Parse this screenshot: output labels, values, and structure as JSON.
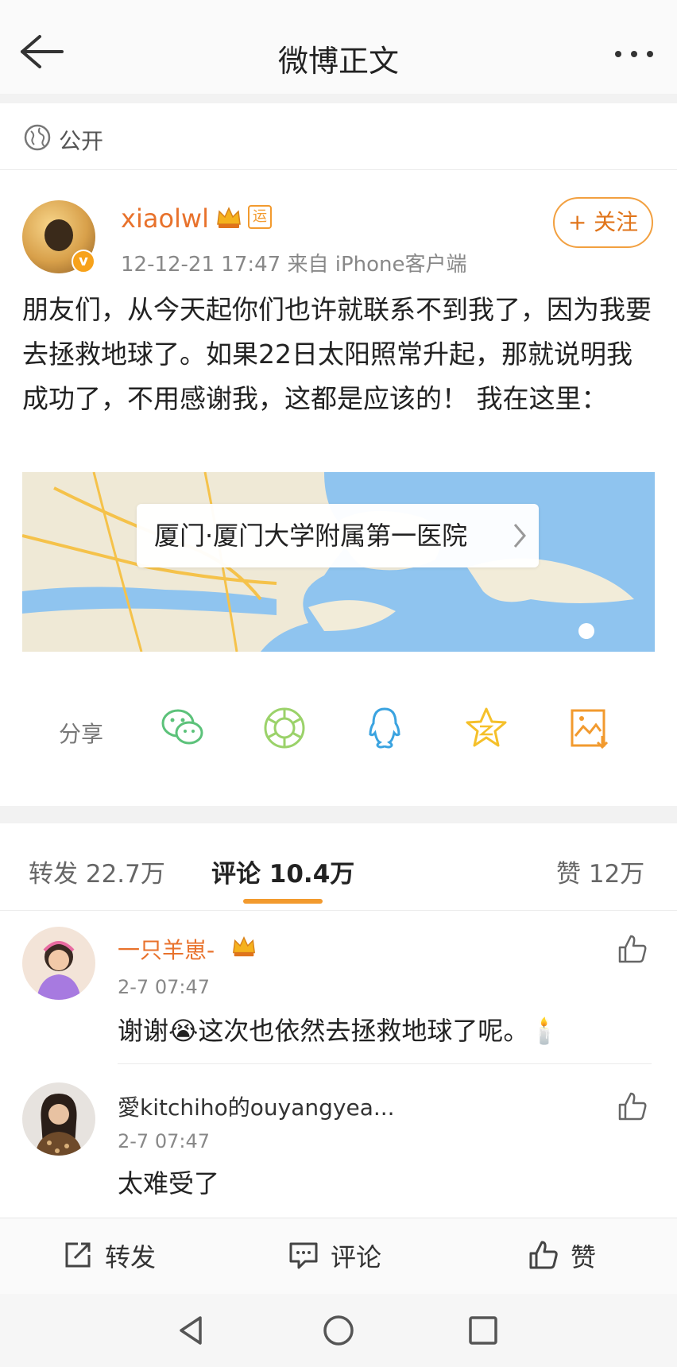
{
  "header": {
    "title": "微博正文"
  },
  "privacy": {
    "label": "公开"
  },
  "post": {
    "username": "xiaolwl",
    "run_badge": "运",
    "verified_badge": "v",
    "meta": "12-12-21 17:47  来自 iPhone客户端",
    "follow_label": "+ 关注",
    "text": "朋友们，从今天起你们也许就联系不到我了，因为我要去拯救地球了。如果22日太阳照常升起，那就说明我成功了，不用感谢我，这都是应该的！ 我在这里：",
    "location": "厦门·厦门大学附属第一医院"
  },
  "share": {
    "label": "分享",
    "icons": [
      "wechat-icon",
      "moments-icon",
      "qq-icon",
      "qzone-icon",
      "save-image-icon"
    ]
  },
  "tabs": {
    "repost": "转发 22.7万",
    "comment": "评论 10.4万",
    "like": "赞 12万"
  },
  "comments": [
    {
      "name": "一只羊崽-",
      "time": "2-7 07:47",
      "text": "谢谢😭这次也依然去拯救地球了呢。🕯️",
      "name_color": "#e8722c"
    },
    {
      "name": "愛kitchiho的ouyangyea...",
      "time": "2-7 07:47",
      "text": "太难受了",
      "name_color": "#333333"
    }
  ],
  "bottom_bar": {
    "repost": "转发",
    "comment": "评论",
    "like": "赞"
  },
  "colors": {
    "accent": "#f29a2e",
    "username": "#e8722c",
    "share_green": "#5cc27a",
    "share_blue": "#3aa3e0",
    "share_yellow": "#f5c02a",
    "share_orange": "#f29a2e"
  }
}
